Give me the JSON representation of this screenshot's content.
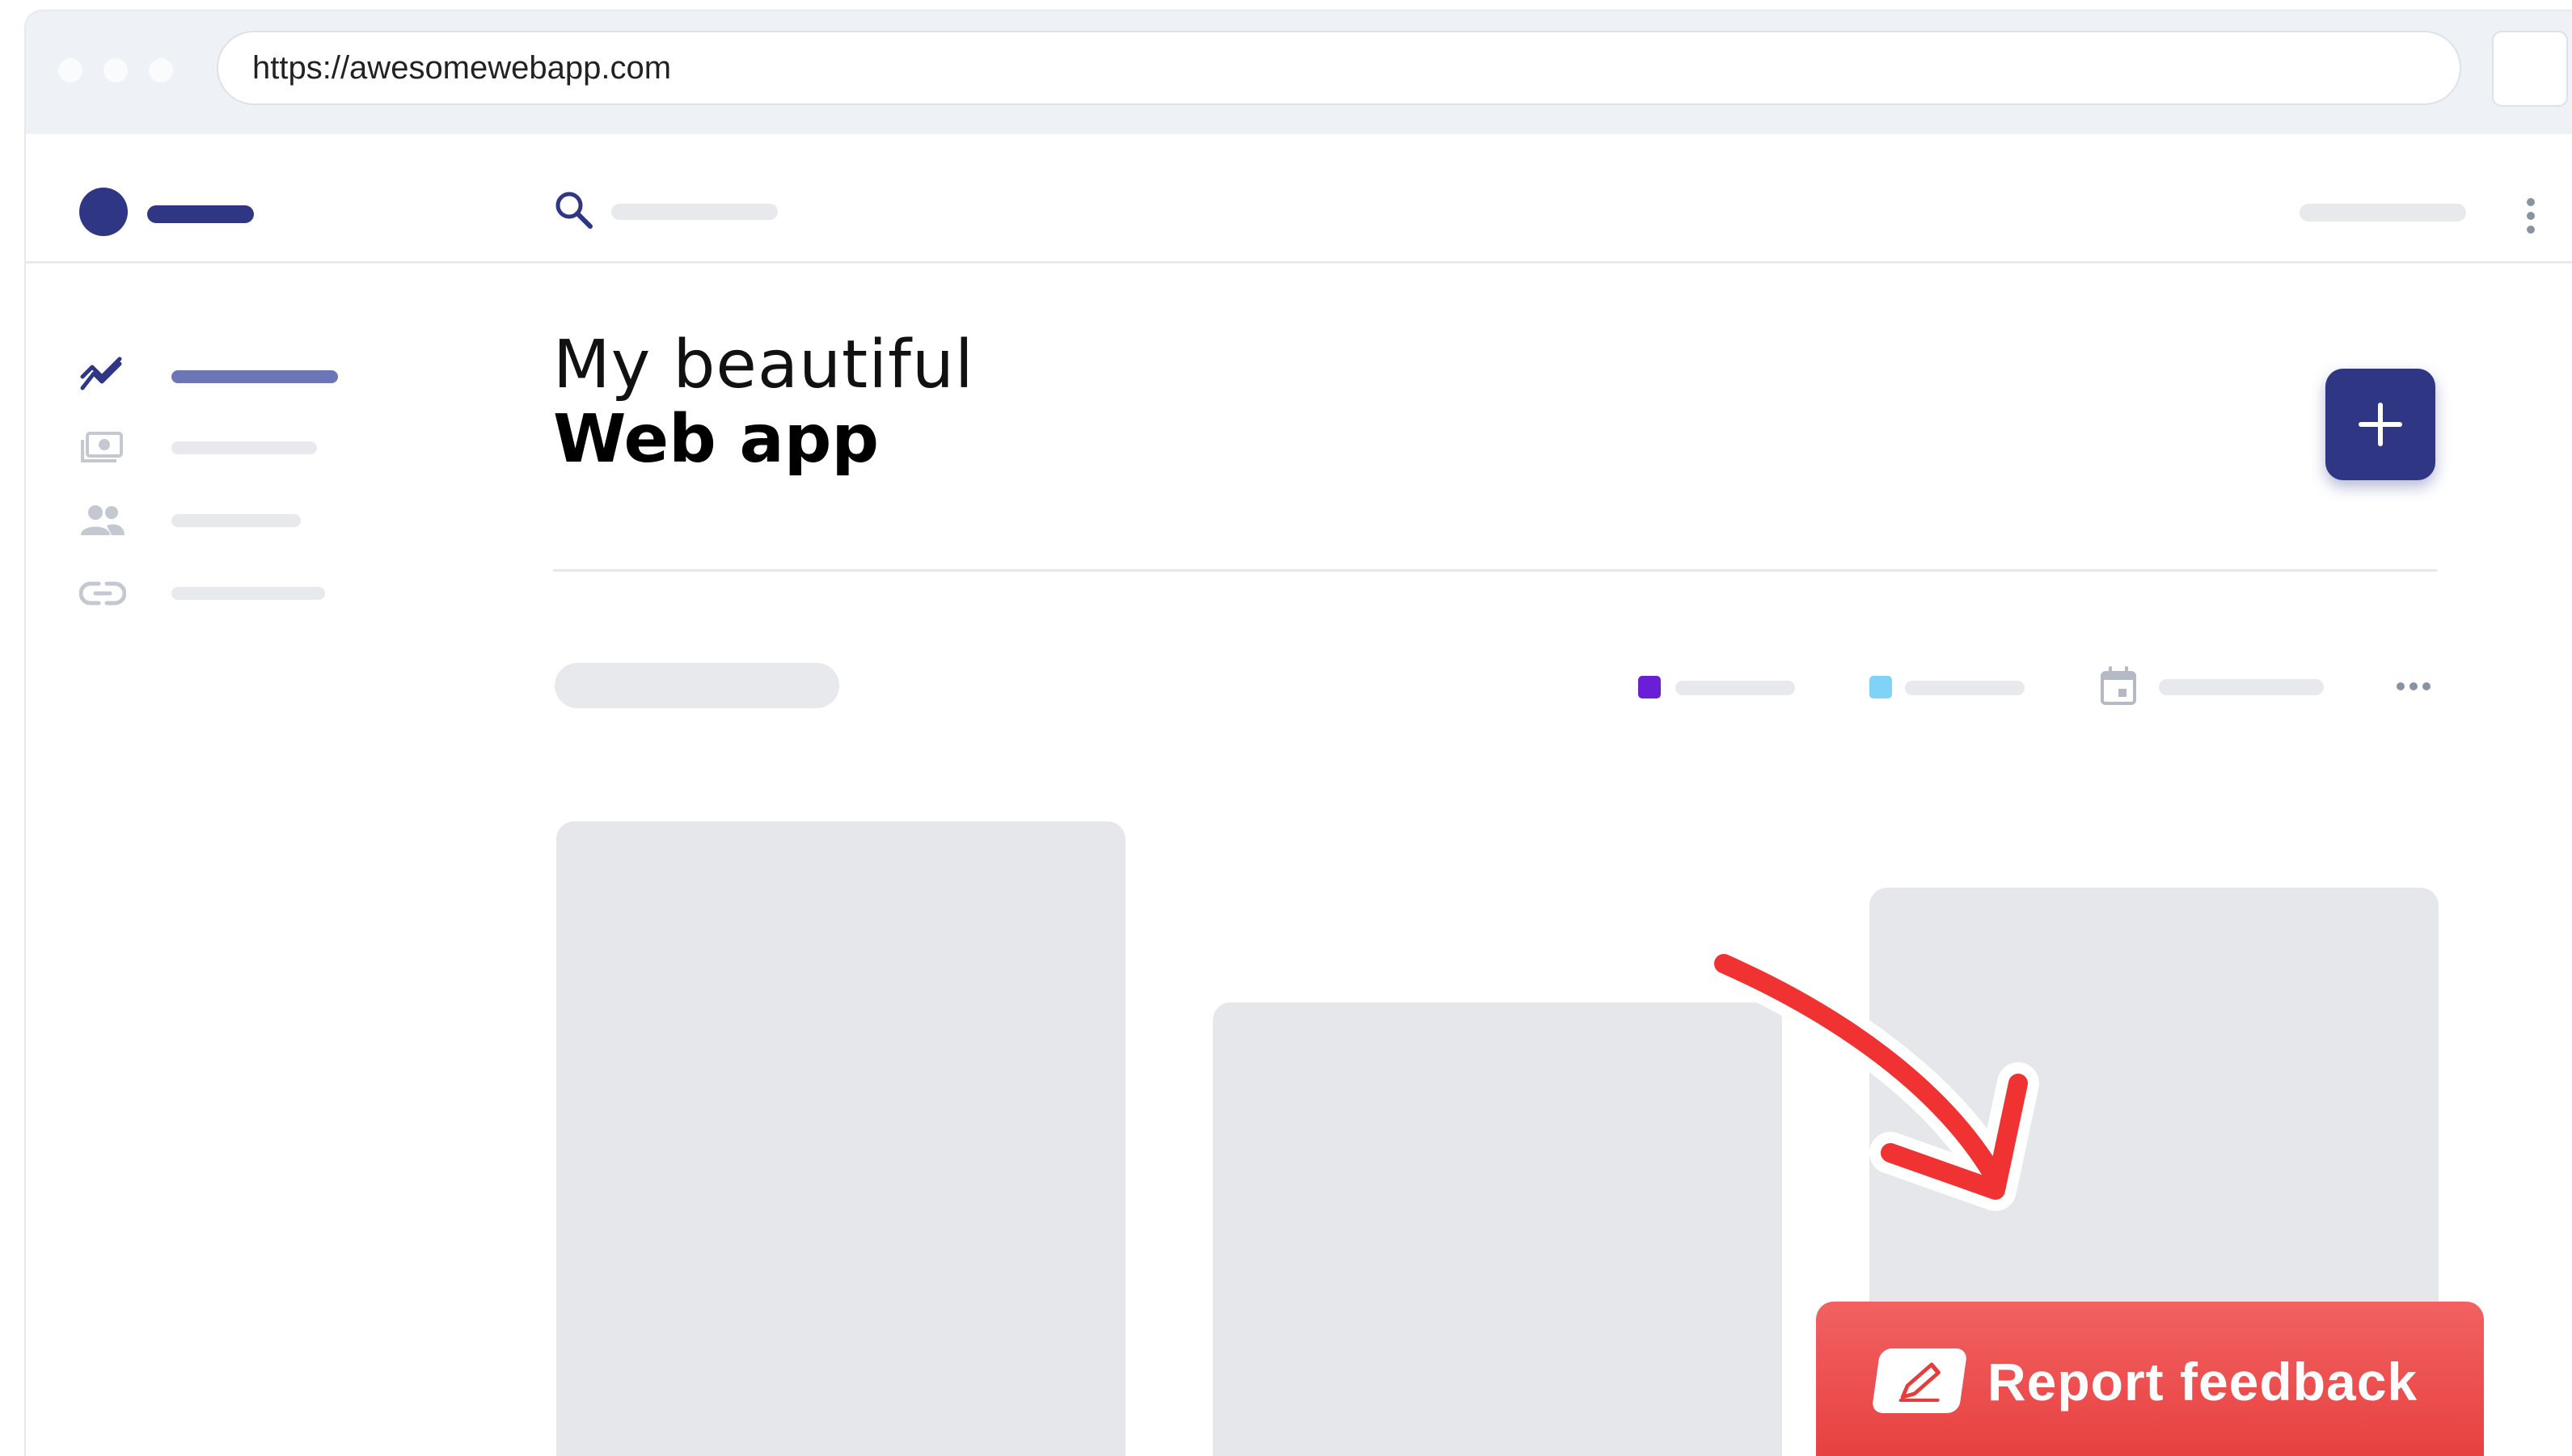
{
  "browser": {
    "url": "https://awesomewebapp.com"
  },
  "page": {
    "title_line1": "My beautiful",
    "title_line2": "Web app"
  },
  "actions": {
    "add_symbol": "+",
    "report_feedback_label": "Report feedback"
  },
  "icons": {
    "search": "search-icon",
    "kebab": "more-vertical-icon",
    "trend": "trend-icon",
    "money": "money-icon",
    "users": "users-icon",
    "link": "link-icon",
    "calendar": "calendar-icon",
    "more": "more-horizontal-icon",
    "plus": "plus-icon",
    "pencil": "pencil-icon",
    "arrow": "curved-arrow-icon"
  },
  "colors": {
    "brand": "#2f3784",
    "legend_1": "#6a1fd6",
    "legend_2": "#7fd3f7",
    "report": "#e94545",
    "arrow": "#f03232"
  }
}
